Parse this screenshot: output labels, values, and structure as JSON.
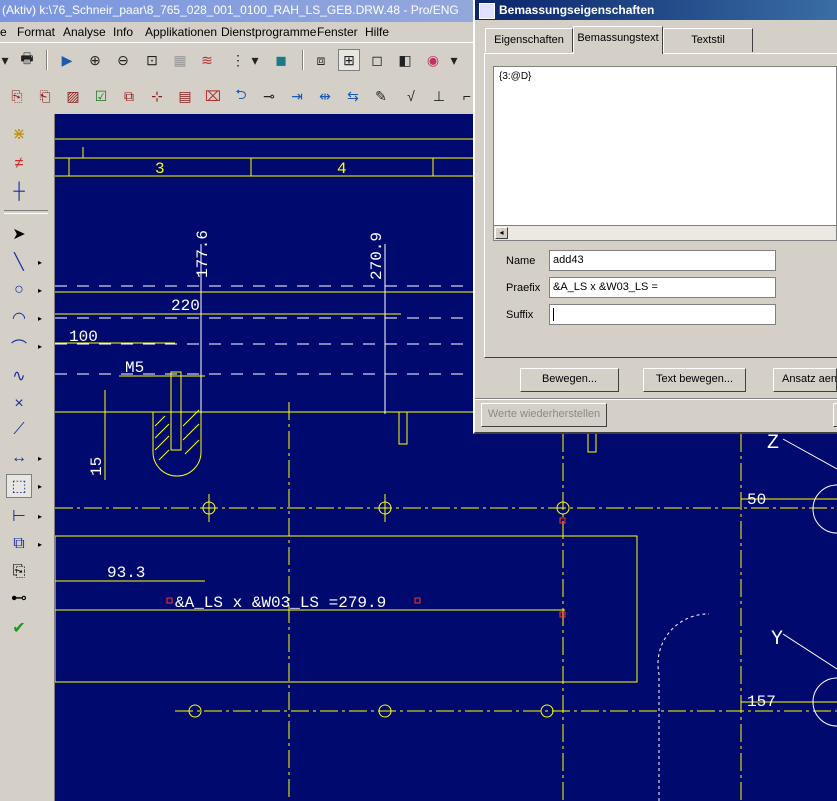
{
  "window": {
    "title": "(Aktiv) k:\\76_Schneir_paar\\8_765_028_001_0100_RAH_LS_GEB.DRW.48 - Pro/ENG"
  },
  "menu": [
    "e",
    "Format",
    "Analyse",
    "Info",
    "Applikationen",
    "Dienstprogramme",
    "Fenster",
    "Hilfe"
  ],
  "dialog": {
    "title": "Bemassungseigenschaften",
    "tabs": [
      "Eigenschaften",
      "Bemassungstext",
      "Textstil"
    ],
    "text_content": "{3:@D}",
    "name_label": "Name",
    "name_value": "add43",
    "prefix_label": "Praefix",
    "prefix_value": "&A_LS x &W03_LS =",
    "suffix_label": "Suffix",
    "suffix_value": "",
    "buttons": {
      "move": "Bewegen...",
      "move_text": "Text bewegen...",
      "approach": "Ansatz aend",
      "restore": "Werte wiederherstellen"
    }
  },
  "drawing": {
    "grid_labels": [
      "3",
      "4"
    ],
    "dims": {
      "d177": "177.6",
      "d270": "270.9",
      "d220": "220",
      "d100": "100",
      "m5": "M5",
      "d15": "15",
      "d50": "50",
      "d93": "93.3",
      "d157": "157",
      "selected": "&A_LS x &W03_LS =279.9",
      "z": "Z",
      "y": "Y"
    }
  },
  "colors": {
    "canvas": "#000a6e",
    "geometry": "#ffff00",
    "dim": "#ffffff",
    "center": "#ffff00",
    "select": "#ff3030"
  }
}
